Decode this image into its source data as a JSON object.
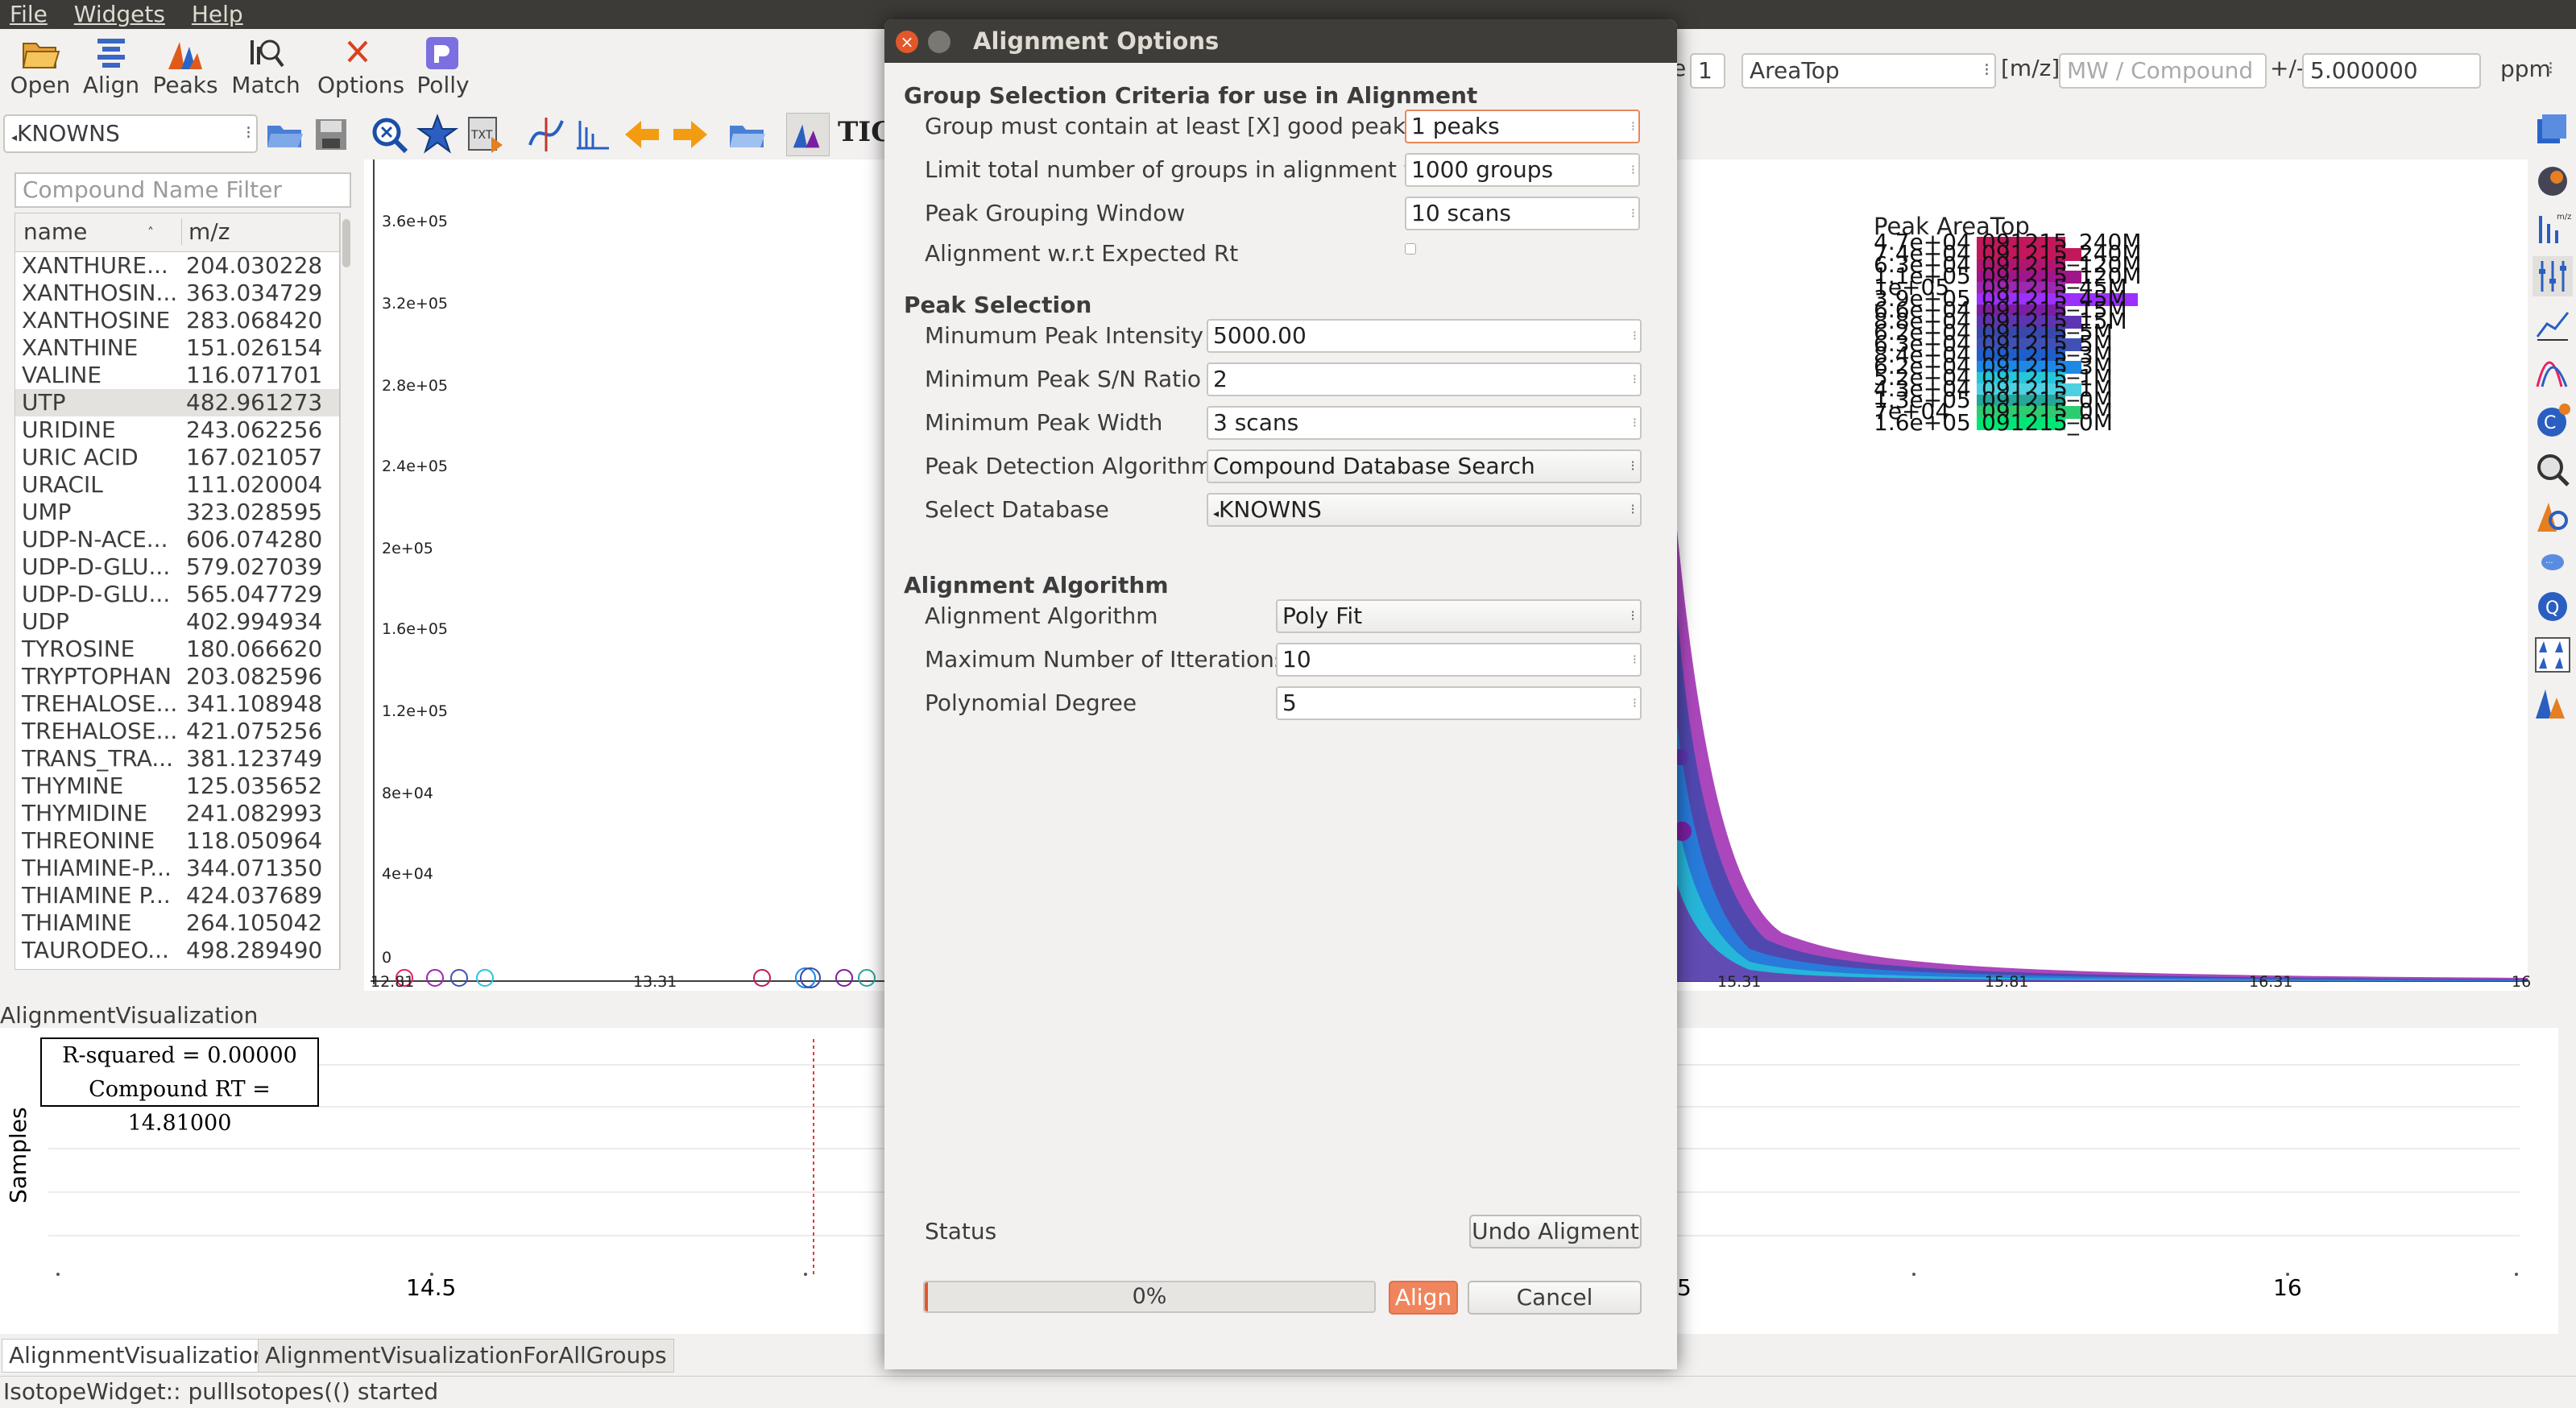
{
  "menu": [
    "File",
    "Widgets",
    "Help"
  ],
  "toolbar": {
    "buttons": [
      {
        "label": "Open",
        "icon": "folder-open-icon"
      },
      {
        "label": "Align",
        "icon": "align-icon"
      },
      {
        "label": "Peaks",
        "icon": "peaks-icon"
      },
      {
        "label": "Match",
        "icon": "match-icon"
      },
      {
        "label": "Options",
        "icon": "options-icon"
      },
      {
        "label": "Polly",
        "icon": "polly-icon"
      }
    ],
    "right": {
      "e_label": "e",
      "charge_value": "1",
      "quant_type": "AreaTop",
      "mz_label": "[m/z]",
      "mw_placeholder": "MW / Compound",
      "tolerance_label": "+/-",
      "tolerance_value": "5.000000",
      "unit": "ppm"
    }
  },
  "toolbar2": {
    "database": "KNOWNS",
    "tic_label": "TIC"
  },
  "compound_list": {
    "filter_placeholder": "Compound Name Filter",
    "col_name": "name",
    "col_mz": "m/z",
    "rows": [
      {
        "name": "XANTHURE...",
        "mz": "204.030228"
      },
      {
        "name": "XANTHOSIN...",
        "mz": "363.034729"
      },
      {
        "name": "XANTHOSINE",
        "mz": "283.068420"
      },
      {
        "name": "XANTHINE",
        "mz": "151.026154"
      },
      {
        "name": "VALINE",
        "mz": "116.071701"
      },
      {
        "name": "UTP",
        "mz": "482.961273"
      },
      {
        "name": "URIDINE",
        "mz": "243.062256"
      },
      {
        "name": "URIC ACID",
        "mz": "167.021057"
      },
      {
        "name": "URACIL",
        "mz": "111.020004"
      },
      {
        "name": "UMP",
        "mz": "323.028595"
      },
      {
        "name": "UDP-N-ACE...",
        "mz": "606.074280"
      },
      {
        "name": "UDP-D-GLU...",
        "mz": "579.027039"
      },
      {
        "name": "UDP-D-GLU...",
        "mz": "565.047729"
      },
      {
        "name": "UDP",
        "mz": "402.994934"
      },
      {
        "name": "TYROSINE",
        "mz": "180.066620"
      },
      {
        "name": "TRYPTOPHAN",
        "mz": "203.082596"
      },
      {
        "name": "TREHALOSE...",
        "mz": "341.108948"
      },
      {
        "name": "TREHALOSE...",
        "mz": "421.075256"
      },
      {
        "name": "TRANS_TRA...",
        "mz": "381.123749"
      },
      {
        "name": "THYMINE",
        "mz": "125.035652"
      },
      {
        "name": "THYMIDINE",
        "mz": "241.082993"
      },
      {
        "name": "THREONINE",
        "mz": "118.050964"
      },
      {
        "name": "THIAMINE-P...",
        "mz": "344.071350"
      },
      {
        "name": "THIAMINE P...",
        "mz": "424.037689"
      },
      {
        "name": "THIAMINE",
        "mz": "264.105042"
      },
      {
        "name": "TAURODEO...",
        "mz": "498.289490"
      }
    ],
    "selected_index": 5
  },
  "chart": {
    "y_ticks": [
      "3.6e+05",
      "3.2e+05",
      "2.8e+05",
      "2.4e+05",
      "2e+05",
      "1.6e+05",
      "1.2e+05",
      "8e+04",
      "4e+04",
      "0"
    ],
    "x_ticks": [
      "12.81",
      "13.31",
      "15.31",
      "15.81",
      "16.31",
      "16"
    ],
    "legend_title": "Peak AreaTop",
    "legend_values": [
      "4.7e+04",
      "7.4e+04",
      "6.3e+04",
      "1.1e+05",
      "1e+05",
      "3.9e+05",
      "6.6e+04",
      "8.8e+04",
      "6.2e+04",
      "6.3e+04",
      "8.4e+04",
      "6.2e+04",
      "5.2e+04",
      "4.3e+04",
      "1.3e+05",
      "7e+04",
      "1.6e+05"
    ],
    "legend_names": [
      "091215_240M",
      "091215_240M",
      "091215_120M",
      "091215_120M",
      "091215_45M",
      "091215_45M",
      "091215_15M",
      "091215_15M",
      "091215_5M",
      "091215_5M",
      "091215_3M",
      "091215_3M",
      "091215_1M",
      "091215_1M",
      "091215_0M",
      "091215_0M",
      "091215_0M"
    ],
    "legend_colors": [
      "#c2185b",
      "#c2185b",
      "#b0166f",
      "#a0168a",
      "#9c27b0",
      "#9b30ff",
      "#7b1fa2",
      "#5e35b1",
      "#3949ab",
      "#3f51b5",
      "#1e5fcc",
      "#1e88e5",
      "#26c6da",
      "#4dd0e1",
      "#26a69a",
      "#2ecc71",
      "#00e676"
    ]
  },
  "alignment_viz": {
    "title": "AlignmentVisualization",
    "r_squared": "R-squared = 0.00000",
    "compound_rt": "Compound RT = 14.81000",
    "y_label": "Samples",
    "x_ticks": [
      "14.5",
      "5",
      "16"
    ]
  },
  "bottom_tabs": [
    "AlignmentVisualization",
    "AlignmentVisualizationForAllGroups"
  ],
  "status": "IsotopeWidget:: pullIsotopes(() started",
  "dialog": {
    "title": "Alignment Options",
    "group_section": "Group Selection Criteria for use in Alignment",
    "group_min_label": "Group must contain at least  [X] good peaks",
    "group_min_value": "1 peaks",
    "limit_label": "Limit total number of groups in alignment to",
    "limit_value": "1000 groups",
    "window_label": "Peak Grouping Window",
    "window_value": "10 scans",
    "expected_rt_label": "Alignment w.r.t Expected Rt",
    "peak_section": "Peak Selection",
    "min_intensity_label": "Minumum Peak Intensity",
    "min_intensity_value": "5000.00",
    "min_sn_label": "Minimum Peak S/N Ratio",
    "min_sn_value": "2",
    "min_width_label": "Minimum Peak Width",
    "min_width_value": "3 scans",
    "detect_label": "Peak Detection Algorithm",
    "detect_value": "Compound Database Search",
    "db_label": "Select Database",
    "db_value": "KNOWNS",
    "algo_section": "Alignment Algorithm",
    "algo_label": "Alignment Algorithm",
    "algo_value": "Poly Fit",
    "iter_label": "Maximum Number of Itterations",
    "iter_value": "10",
    "degree_label": "Polynomial Degree",
    "degree_value": "5",
    "status_label": "Status",
    "undo_button": "Undo Aligment",
    "progress_text": "0%",
    "progress_fraction": 0.0,
    "align_button": "Align",
    "cancel_button": "Cancel"
  }
}
